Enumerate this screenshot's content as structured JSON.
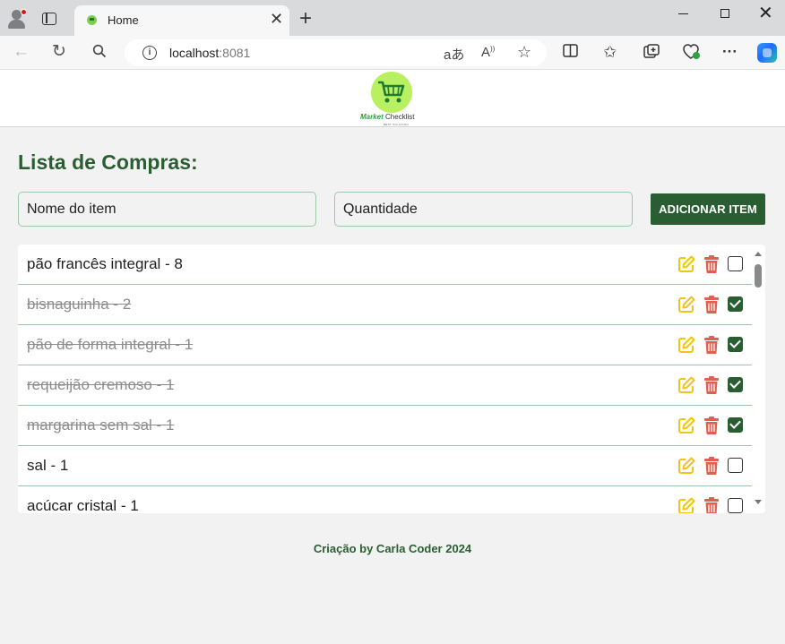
{
  "browser": {
    "tab_title": "Home",
    "url_host": "localhost",
    "url_port": ":8081"
  },
  "header": {
    "logo_word1": "Market",
    "logo_word2": "Checklist",
    "logo_tagline": "BEST SOLUTION"
  },
  "main": {
    "title": "Lista de Compras:",
    "name_placeholder": "Nome do item",
    "qty_placeholder": "Quantidade",
    "add_button": "ADICIONAR ITEM"
  },
  "items": [
    {
      "label": "pão francês integral - 8",
      "checked": false
    },
    {
      "label": "bisnaguinha - 2",
      "checked": true
    },
    {
      "label": "pão de forma integral - 1",
      "checked": true
    },
    {
      "label": "requeijão cremoso - 1",
      "checked": true
    },
    {
      "label": "margarina sem sal - 1",
      "checked": true
    },
    {
      "label": "sal - 1",
      "checked": false
    },
    {
      "label": "acúcar cristal - 1",
      "checked": false
    }
  ],
  "colors": {
    "brand_green": "#2a5e32",
    "edit_yellow": "#f2c418",
    "delete_red": "#e06050"
  },
  "footer": {
    "text": "Criação by Carla Coder 2024"
  }
}
